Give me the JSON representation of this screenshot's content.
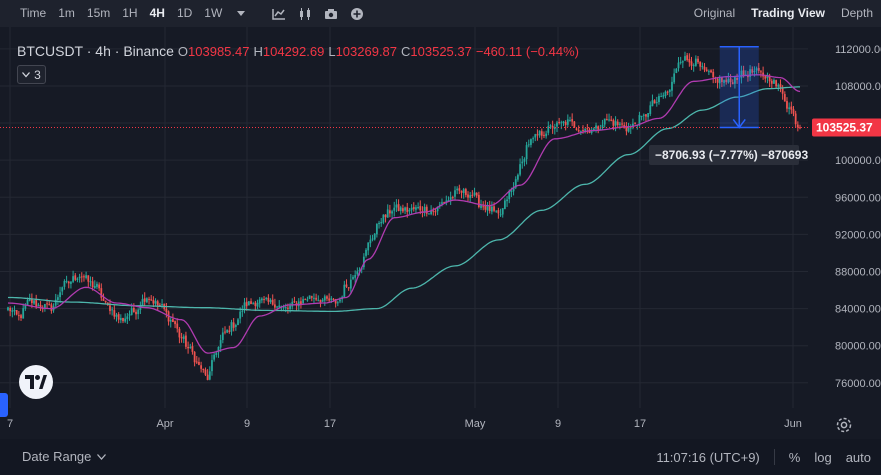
{
  "toolbar": {
    "items": [
      "Time",
      "1m",
      "15m",
      "1H",
      "4H",
      "1D",
      "1W"
    ],
    "active": "4H",
    "right": [
      "Original",
      "Trading View",
      "Depth"
    ],
    "right_active": "Trading View"
  },
  "legend": {
    "symbol": "BTCUSDT · 4h · Binance",
    "o_label": "O",
    "o": "103985.47",
    "h_label": "H",
    "h": "104292.69",
    "l_label": "L",
    "l": "103269.87",
    "c_label": "C",
    "c": "103525.37",
    "change": "−460.11 (−0.44%)",
    "indicators_count": "3"
  },
  "bottom": {
    "date_range": "Date Range",
    "time": "11:07:16 (UTC+9)",
    "pct": "%",
    "log": "log",
    "auto": "auto"
  },
  "colors": {
    "up": "#26a69a",
    "down": "#ef5350",
    "ma_fast": "#b03bb0",
    "ma_slow": "#4db6ac",
    "price_tag": "#f23645",
    "measure": "#2962ff"
  },
  "chart_data": {
    "type": "candlestick",
    "symbol": "BTCUSDT",
    "interval": "4h",
    "exchange": "Binance",
    "last_price": 103525.37,
    "last_price_label": "103525.37",
    "ylim": [
      73500,
      113600
    ],
    "yticks": [
      76000,
      80000,
      84000,
      88000,
      92000,
      96000,
      100000,
      104000,
      108000,
      112000
    ],
    "ytick_labels": [
      "76000.00",
      "80000.00",
      "84000.00",
      "88000.00",
      "92000.00",
      "96000.00",
      "100000.00",
      "104000.00",
      "108000.00",
      "112000.00"
    ],
    "xticks": [
      "7",
      "Apr",
      "9",
      "17",
      "May",
      "9",
      "17",
      "Jun"
    ],
    "measure": {
      "from": 112232,
      "to": 103525,
      "label": "−8706.93 (−7.77%) −870693"
    },
    "close_anchors": [
      [
        0,
        84000
      ],
      [
        5,
        83100
      ],
      [
        10,
        84800
      ],
      [
        15,
        84300
      ],
      [
        20,
        84100
      ],
      [
        26,
        86600
      ],
      [
        33,
        87600
      ],
      [
        40,
        86500
      ],
      [
        46,
        84200
      ],
      [
        52,
        82800
      ],
      [
        58,
        83700
      ],
      [
        64,
        85300
      ],
      [
        70,
        84300
      ],
      [
        76,
        82600
      ],
      [
        80,
        80800
      ],
      [
        84,
        79500
      ],
      [
        88,
        77800
      ],
      [
        92,
        76500
      ],
      [
        96,
        79500
      ],
      [
        100,
        81400
      ],
      [
        104,
        82300
      ],
      [
        110,
        84500
      ],
      [
        116,
        84800
      ],
      [
        122,
        84600
      ],
      [
        128,
        84000
      ],
      [
        134,
        84700
      ],
      [
        140,
        85300
      ],
      [
        146,
        84900
      ],
      [
        152,
        84700
      ],
      [
        156,
        86500
      ],
      [
        162,
        88500
      ],
      [
        168,
        91800
      ],
      [
        172,
        93700
      ],
      [
        178,
        94800
      ],
      [
        184,
        94600
      ],
      [
        190,
        94800
      ],
      [
        196,
        94500
      ],
      [
        202,
        95700
      ],
      [
        208,
        96600
      ],
      [
        214,
        96300
      ],
      [
        218,
        95200
      ],
      [
        222,
        94700
      ],
      [
        226,
        94000
      ],
      [
        232,
        96600
      ],
      [
        236,
        99200
      ],
      [
        240,
        101900
      ],
      [
        246,
        102900
      ],
      [
        252,
        103700
      ],
      [
        258,
        104100
      ],
      [
        264,
        103400
      ],
      [
        270,
        103300
      ],
      [
        276,
        104300
      ],
      [
        282,
        103800
      ],
      [
        286,
        103400
      ],
      [
        292,
        104500
      ],
      [
        298,
        106200
      ],
      [
        304,
        107300
      ],
      [
        310,
        111000
      ],
      [
        316,
        110600
      ],
      [
        322,
        109400
      ],
      [
        326,
        108700
      ],
      [
        332,
        108400
      ],
      [
        338,
        109200
      ],
      [
        344,
        109500
      ],
      [
        350,
        109000
      ],
      [
        356,
        107700
      ],
      [
        360,
        105600
      ],
      [
        365,
        103525
      ]
    ],
    "ma_fast_anchors": [
      [
        0,
        84600
      ],
      [
        20,
        84000
      ],
      [
        36,
        86300
      ],
      [
        50,
        84600
      ],
      [
        64,
        84100
      ],
      [
        80,
        82800
      ],
      [
        92,
        79200
      ],
      [
        104,
        79800
      ],
      [
        116,
        83200
      ],
      [
        130,
        84400
      ],
      [
        146,
        84600
      ],
      [
        156,
        85200
      ],
      [
        166,
        89300
      ],
      [
        178,
        93800
      ],
      [
        192,
        94400
      ],
      [
        206,
        95700
      ],
      [
        222,
        95100
      ],
      [
        236,
        97300
      ],
      [
        252,
        102300
      ],
      [
        270,
        103200
      ],
      [
        286,
        103600
      ],
      [
        300,
        104500
      ],
      [
        316,
        108500
      ],
      [
        332,
        109000
      ],
      [
        346,
        109200
      ],
      [
        356,
        108900
      ],
      [
        365,
        107400
      ]
    ],
    "ma_slow_anchors": [
      [
        0,
        85200
      ],
      [
        30,
        84700
      ],
      [
        60,
        84300
      ],
      [
        90,
        84100
      ],
      [
        120,
        83800
      ],
      [
        150,
        83700
      ],
      [
        170,
        84000
      ],
      [
        186,
        86200
      ],
      [
        206,
        88600
      ],
      [
        226,
        91400
      ],
      [
        246,
        94600
      ],
      [
        266,
        97400
      ],
      [
        286,
        100600
      ],
      [
        304,
        103400
      ],
      [
        320,
        105400
      ],
      [
        336,
        106800
      ],
      [
        350,
        107700
      ],
      [
        365,
        107900
      ]
    ]
  }
}
